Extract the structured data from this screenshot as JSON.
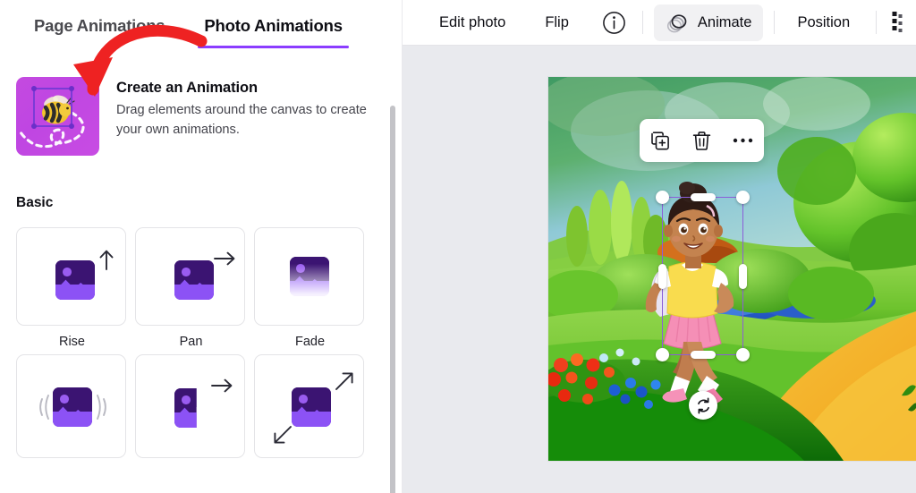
{
  "left_panel": {
    "tabs": [
      {
        "label": "Page Animations",
        "active": false,
        "name": "tab-page-animations"
      },
      {
        "label": "Photo Animations",
        "active": true,
        "name": "tab-photo-animations"
      }
    ],
    "create_card": {
      "title": "Create an Animation",
      "description": "Drag elements around the canvas to create your own animations.",
      "thumbnail_icon": "bee-motion-path-icon",
      "thumbnail_color": "#c44ae0"
    },
    "section_label": "Basic",
    "animations": [
      {
        "label": "Rise",
        "icon": "image-arrow-up-icon",
        "name": "animation-tile-rise"
      },
      {
        "label": "Pan",
        "icon": "image-arrow-right-icon",
        "name": "animation-tile-pan"
      },
      {
        "label": "Fade",
        "icon": "image-fade-icon",
        "name": "animation-tile-fade"
      },
      {
        "label": "",
        "icon": "image-pop-waves-icon",
        "name": "animation-tile-pop"
      },
      {
        "label": "",
        "icon": "image-wipe-arrow-icon",
        "name": "animation-tile-wipe"
      },
      {
        "label": "",
        "icon": "image-breathe-diagonal-icon",
        "name": "animation-tile-breathe"
      }
    ],
    "accent_color": "#8b3dff"
  },
  "annotation": {
    "arrow_color": "#ee2222",
    "name": "red-annotation-arrow",
    "points_to": "Create an Animation"
  },
  "toolbar": {
    "items": [
      {
        "label": "Edit photo",
        "name": "edit-photo-button",
        "active": false
      },
      {
        "label": "Flip",
        "name": "flip-button",
        "active": false
      },
      {
        "label": "",
        "name": "info-icon",
        "active": false,
        "icon": "info-circle-icon"
      },
      {
        "label": "Animate",
        "name": "animate-button",
        "active": true,
        "icon": "stacked-circles-icon"
      },
      {
        "label": "Position",
        "name": "position-button",
        "active": false
      },
      {
        "label": "",
        "name": "more-options-grid-icon",
        "active": false,
        "icon": "dots-grid-icon"
      }
    ],
    "active_background": "#f1f1f3",
    "cursor_icon": "hand-pointer-cursor"
  },
  "canvas": {
    "background_color": "#e9eaee",
    "photo": {
      "alt": "Illustrated girl with backpack walking on a path in a green cartoon landscape",
      "name": "canvas-photo"
    },
    "float_toolbar": [
      {
        "icon": "duplicate-icon",
        "name": "duplicate-button"
      },
      {
        "icon": "trash-icon",
        "name": "delete-button"
      },
      {
        "icon": "ellipsis-icon",
        "name": "more-actions-button"
      }
    ],
    "selection": {
      "name": "selection-box",
      "border_color": "#8b5ed8",
      "handles": [
        "top-left",
        "top-right",
        "bottom-left",
        "bottom-right",
        "top",
        "bottom",
        "left",
        "right"
      ]
    },
    "rotate_handle": {
      "icon": "rotate-icon",
      "name": "rotate-handle"
    }
  }
}
